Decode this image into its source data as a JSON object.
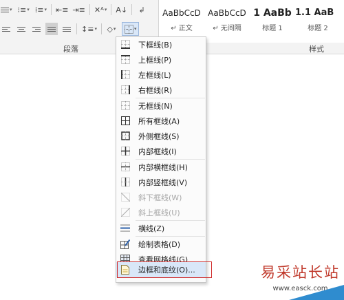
{
  "group_label": "段落",
  "styles_label": "样式",
  "styles": [
    {
      "preview": "AaBbCcD",
      "name": "↵ 正文"
    },
    {
      "preview": "AaBbCcD",
      "name": "↵ 无间隔"
    },
    {
      "preview": "1 AaBb",
      "name": "标题 1"
    },
    {
      "preview": "1.1 AaB",
      "name": "标题 2"
    }
  ],
  "menu": {
    "items": [
      {
        "label": "下框线(B)",
        "icon": "border-bottom-icon",
        "disabled": false
      },
      {
        "label": "上框线(P)",
        "icon": "border-top-icon",
        "disabled": false
      },
      {
        "label": "左框线(L)",
        "icon": "border-left-icon",
        "disabled": false
      },
      {
        "label": "右框线(R)",
        "icon": "border-right-icon",
        "disabled": false
      },
      {
        "label": "无框线(N)",
        "icon": "no-border-icon",
        "disabled": false
      },
      {
        "label": "所有框线(A)",
        "icon": "all-borders-icon",
        "disabled": false
      },
      {
        "label": "外侧框线(S)",
        "icon": "outside-borders-icon",
        "disabled": false
      },
      {
        "label": "内部框线(I)",
        "icon": "inside-borders-icon",
        "disabled": false
      },
      {
        "label": "内部横框线(H)",
        "icon": "inside-horizontal-border-icon",
        "disabled": false
      },
      {
        "label": "内部竖框线(V)",
        "icon": "inside-vertical-border-icon",
        "disabled": false
      },
      {
        "label": "斜下框线(W)",
        "icon": "diagonal-down-border-icon",
        "disabled": true
      },
      {
        "label": "斜上框线(U)",
        "icon": "diagonal-up-border-icon",
        "disabled": true
      },
      {
        "label": "横线(Z)",
        "icon": "horizontal-line-icon",
        "disabled": false
      },
      {
        "label": "绘制表格(D)",
        "icon": "draw-table-icon",
        "disabled": false
      },
      {
        "label": "查看网格线(G)",
        "icon": "view-gridlines-icon",
        "disabled": false
      },
      {
        "label": "边框和底纹(O)...",
        "icon": "borders-and-shading-icon",
        "disabled": false
      }
    ]
  },
  "watermark": {
    "text": "易采站长站",
    "url": "www.easck.com"
  },
  "colors": {
    "highlight_border": "#d02b2b",
    "watermark_text": "#c0392b",
    "menu_selected_bg": "#d9e7f8"
  }
}
